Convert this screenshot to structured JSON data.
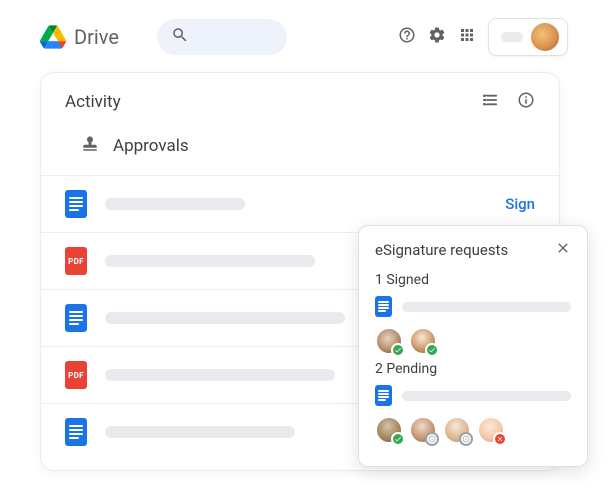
{
  "header": {
    "app_name": "Drive",
    "icons": {
      "search": "search-icon",
      "help": "help-icon",
      "settings": "settings-icon",
      "apps": "apps-icon"
    }
  },
  "activity": {
    "title": "Activity",
    "section": "Approvals",
    "rows": [
      {
        "type": "doc",
        "action": "Sign"
      },
      {
        "type": "pdf"
      },
      {
        "type": "doc"
      },
      {
        "type": "pdf"
      },
      {
        "type": "doc"
      }
    ]
  },
  "esignature": {
    "title": "eSignature requests",
    "sections": [
      {
        "label": "1 Signed",
        "file_type": "doc",
        "signers": [
          {
            "status": "signed"
          },
          {
            "status": "signed"
          }
        ]
      },
      {
        "label": "2 Pending",
        "file_type": "doc",
        "signers": [
          {
            "status": "signed"
          },
          {
            "status": "pending"
          },
          {
            "status": "pending"
          },
          {
            "status": "rejected"
          }
        ]
      }
    ]
  }
}
